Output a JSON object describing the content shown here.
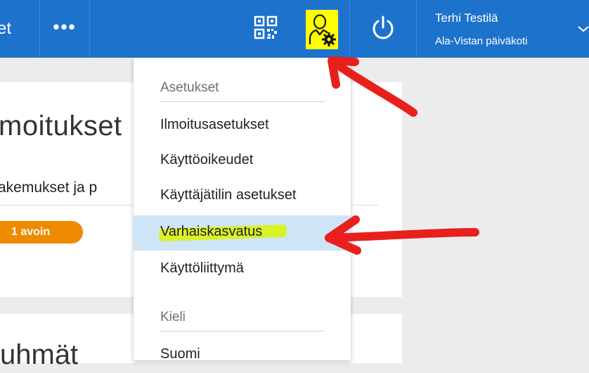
{
  "topbar": {
    "nav_partial_label": "et",
    "more_label": "•••",
    "user_name": "Terhi Testilä",
    "user_unit": "Ala-Vistan päiväkoti",
    "icons": {
      "qr": "qr-code-icon",
      "user_settings": "user-settings-icon",
      "power": "power-icon",
      "chevron": "chevron-down-icon"
    },
    "colors": {
      "bar": "#1d73cc",
      "highlight": "#ffff00"
    }
  },
  "background": {
    "card1_title": "moitukset",
    "card1_subtitle": "akemukset ja p",
    "badge_label": "1 avoin",
    "card2_title": "uhmät"
  },
  "dropdown": {
    "settings_heading": "Asetukset",
    "items": [
      {
        "label": "Ilmoitusasetukset"
      },
      {
        "label": "Käyttöoikeudet"
      },
      {
        "label": "Käyttäjätilin asetukset"
      },
      {
        "label": "Varhaiskasvatus"
      },
      {
        "label": "Käyttöliittymä"
      }
    ],
    "active_index": 3,
    "language_heading": "Kieli",
    "language_items": [
      {
        "label": "Suomi"
      }
    ],
    "colors": {
      "active_bg": "#cde5f7",
      "marker": "#d9f22a"
    }
  },
  "annotations": {
    "arrow_color": "#e8201c"
  }
}
